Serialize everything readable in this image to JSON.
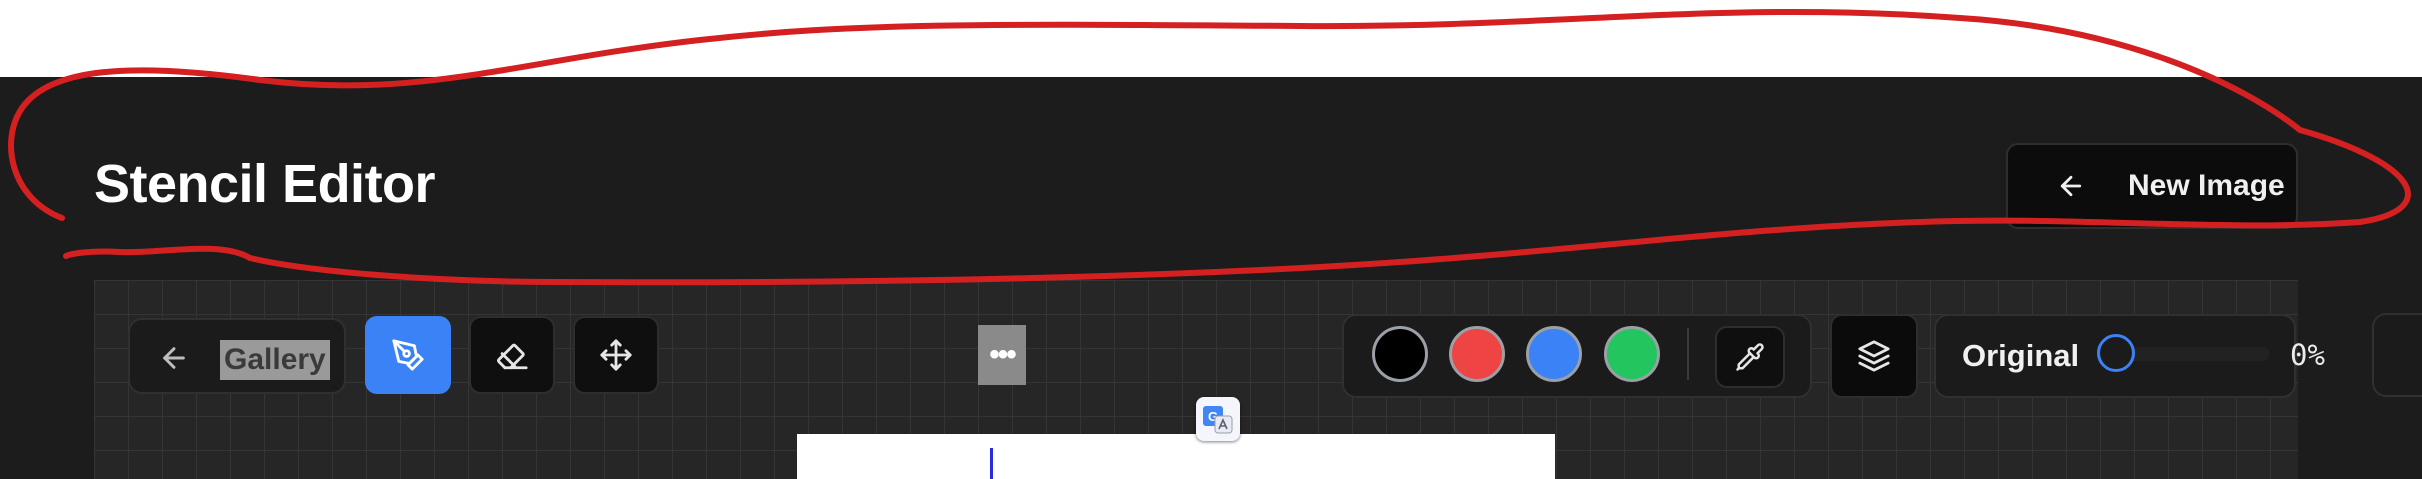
{
  "header": {
    "title": "Stencil Editor",
    "new_image_label": "New Image",
    "new_image_icon": "arrow-left-icon"
  },
  "toolbar": {
    "gallery_label": "Gallery",
    "gallery_icon": "arrow-left-icon",
    "tools": [
      {
        "name": "pen",
        "icon": "pen-nib-icon",
        "active": true
      },
      {
        "name": "eraser",
        "icon": "eraser-icon",
        "active": false
      },
      {
        "name": "move",
        "icon": "move-arrows-icon",
        "active": false
      }
    ],
    "more_label": "•••",
    "colors": [
      "#000000",
      "#ef4444",
      "#3b82f6",
      "#22c55e"
    ],
    "eyedropper_icon": "eyedropper-icon",
    "layers_icon": "layers-icon",
    "mode_label": "Original",
    "opacity_value": "0%",
    "opacity_level": 0
  },
  "theme": {
    "accent": "#3b82f6",
    "background": "#1c1c1c",
    "annotation": "#d42020"
  }
}
